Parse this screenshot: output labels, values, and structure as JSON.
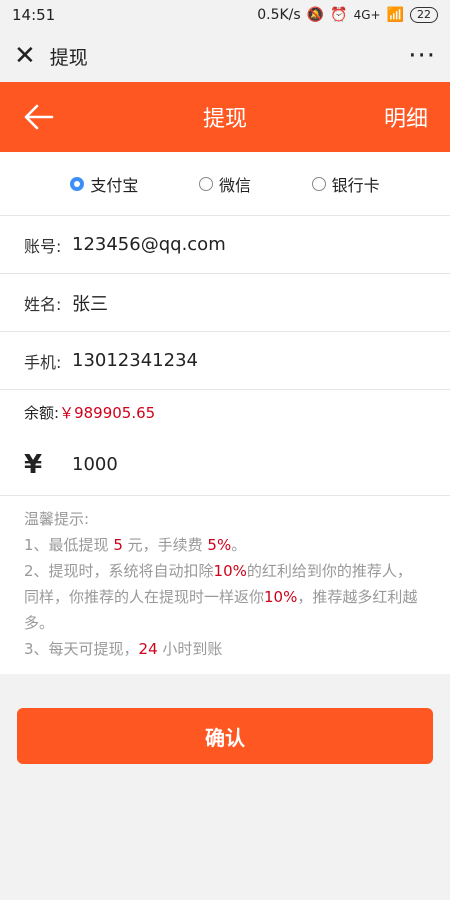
{
  "status_bar": {
    "time": "14:51",
    "speed": "0.5K/s",
    "network": "4G+",
    "battery": "22"
  },
  "wechat_bar": {
    "title": "提现",
    "close_symbol": "✕",
    "more_symbol": "···"
  },
  "header": {
    "title": "提现",
    "detail_label": "明细"
  },
  "methods": [
    {
      "label": "支付宝",
      "selected": true
    },
    {
      "label": "微信",
      "selected": false
    },
    {
      "label": "银行卡",
      "selected": false
    }
  ],
  "form": {
    "account_label": "账号:",
    "account_value": "123456@qq.com",
    "name_label": "姓名:",
    "name_value": "张三",
    "phone_label": "手机:",
    "phone_value": "13012341234"
  },
  "balance": {
    "label": "余额:",
    "value": "￥989905.65"
  },
  "amount": {
    "symbol": "¥",
    "value": "1000"
  },
  "tips": {
    "title": "温馨提示:",
    "line1_a": "1、最低提现 ",
    "line1_b": "5",
    "line1_c": " 元，手续费 ",
    "line1_d": "5%",
    "line1_e": "。",
    "line2_a": "2、提现时，系统将自动扣除",
    "line2_b": "10%",
    "line2_c": "的红利给到你的推荐人，同样，你推荐的人在提现时一样返你",
    "line2_d": "10%",
    "line2_e": "，推荐越多红利越多。",
    "line3_a": "3、每天可提现，",
    "line3_b": "24",
    "line3_c": " 小时到账"
  },
  "confirm_label": "确认",
  "colors": {
    "accent": "#ff5722",
    "highlight": "#d0021b",
    "radio_selected": "#3e8ef7"
  }
}
